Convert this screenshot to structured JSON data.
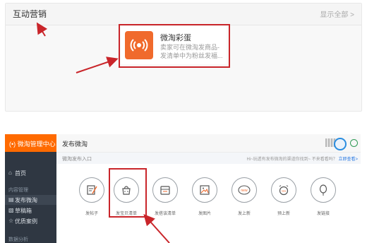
{
  "top_section": {
    "title": "互动营销",
    "show_all": "显示全部 >",
    "card": {
      "title": "微淘彩蛋",
      "desc_line1": "卖家可在微淘发商品-",
      "desc_line2": "发清单中为粉丝发福..."
    }
  },
  "admin": {
    "brand": "微淘管理中心",
    "page_title": "发布微淘",
    "breadcrumb": "微淘发布入口",
    "hint_text": "Hi~玩透有发布微淘的渠道你找到~ 不来看看吗？",
    "hint_link": "立即查看>",
    "nav": {
      "home": "首页",
      "group_content": "内容管理",
      "publish": "发布微淘",
      "drafts": "草稿箱",
      "cases": "优质案例",
      "group_data": "数据分析"
    },
    "tiles": [
      {
        "label": "发帖子",
        "icon": "note-pencil-icon"
      },
      {
        "label": "发宝贝清单",
        "icon": "shopping-bag-icon"
      },
      {
        "label": "发搭该清单",
        "icon": "box-list-icon"
      },
      {
        "label": "发图片",
        "icon": "picture-icon"
      },
      {
        "label": "发上新",
        "icon": "new-badge-icon"
      },
      {
        "label": "预上新",
        "icon": "alarm-clock-icon"
      },
      {
        "label": "发链接",
        "icon": "balloon-icon"
      }
    ]
  },
  "colors": {
    "accent_orange": "#ff6a00",
    "highlight_red": "#c9252a",
    "sidebar_dark": "#2f3742"
  }
}
